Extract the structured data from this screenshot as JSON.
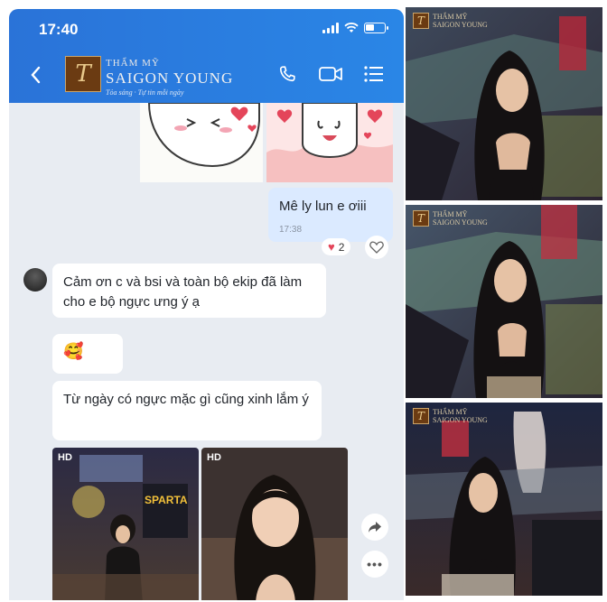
{
  "status_bar": {
    "time": "17:40"
  },
  "header": {
    "brand_line1": "THẨM MỸ",
    "brand_line2": "SAIGON YOUNG",
    "brand_tagline": "Tỏa sáng · Tự tin mỗi ngày"
  },
  "messages": {
    "sent": {
      "text": "Mê ly lun e ơiii",
      "time": "17:38",
      "reaction_count": "2"
    },
    "received": [
      {
        "text": "Cảm ơn c và bsi và toàn bộ ekip đã làm cho e bộ ngực ưng ý ạ"
      },
      {
        "text": "🥰"
      },
      {
        "text": "Từ ngày có ngực mặc gì cũng xinh lắm ý"
      }
    ]
  },
  "photo_badges": {
    "hd_1": "HD",
    "hd_2": "HD",
    "sign_text": "SPARTA"
  },
  "watermark": {
    "line1": "THẨM MỸ",
    "line2": "SAIGON YOUNG"
  },
  "icons": [
    "back-icon",
    "phone-icon",
    "video-icon",
    "menu-icon",
    "heart-icon",
    "share-icon",
    "more-icon"
  ],
  "colors": {
    "header_blue": "#2a7ae0",
    "bubble_mine": "#dbeaff",
    "chat_bg": "#e8ecf2"
  }
}
